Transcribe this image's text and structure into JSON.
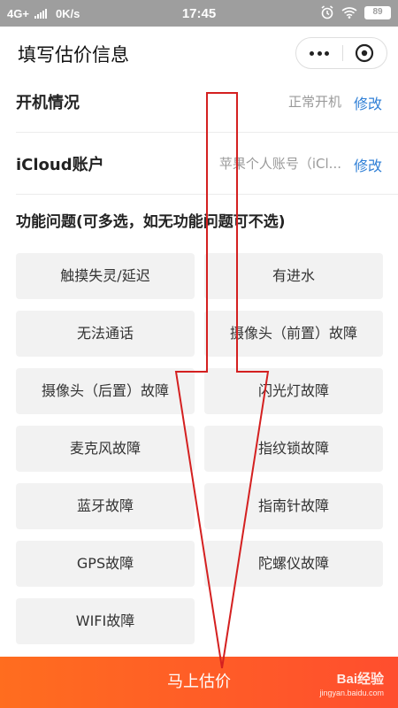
{
  "status_bar": {
    "network": "4G+",
    "speed": "0K/s",
    "time": "17:45",
    "battery": "89"
  },
  "header": {
    "title": "填写估价信息"
  },
  "rows": [
    {
      "label": "开机情况",
      "value": "正常开机",
      "edit_label": "修改"
    },
    {
      "label": "iCloud账户",
      "value": "苹果个人账号（iCl...",
      "edit_label": "修改"
    }
  ],
  "section": {
    "title": "功能问题(可多选，如无功能问题可不选)"
  },
  "options": [
    "触摸失灵/延迟",
    "有进水",
    "无法通话",
    "摄像头（前置）故障",
    "摄像头（后置）故障",
    "闪光灯故障",
    "麦克风故障",
    "指纹锁故障",
    "蓝牙故障",
    "指南针故障",
    "GPS故障",
    "陀螺仪故障",
    "WIFI故障"
  ],
  "bottom": {
    "submit_label": "马上估价"
  },
  "watermark": {
    "brand": "Bai经验",
    "url": "jingyan.baidu.com"
  },
  "colors": {
    "accent_blue": "#2f7fd6",
    "submit_gradient_start": "#ff6d1f",
    "submit_gradient_end": "#ff4e2e",
    "annotation_red": "#d42020"
  }
}
